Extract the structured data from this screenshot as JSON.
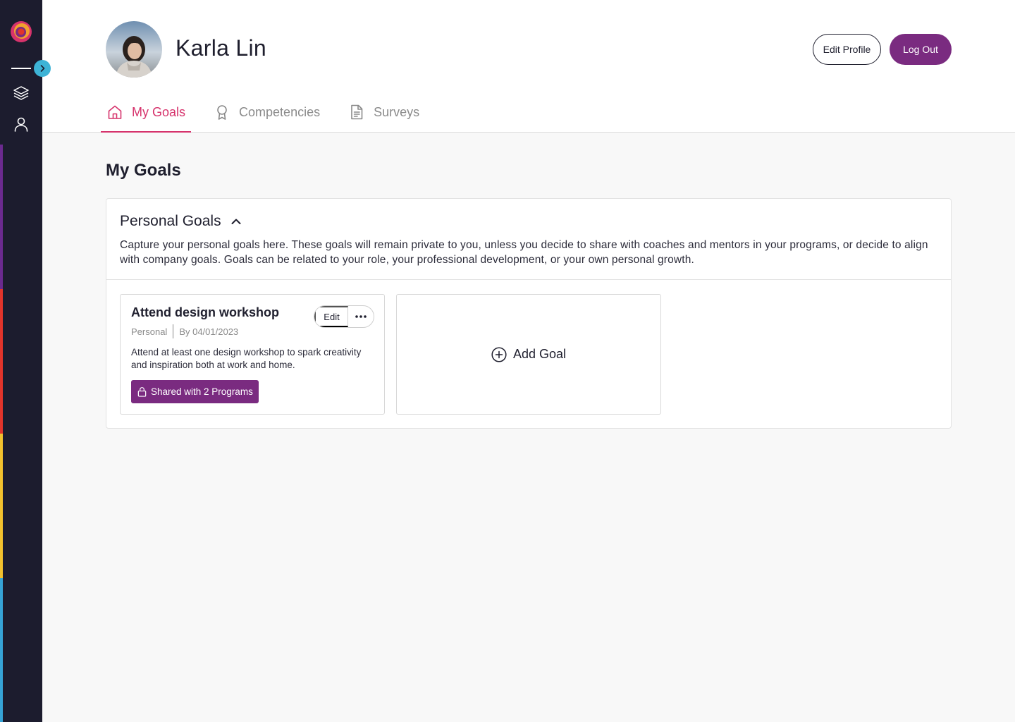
{
  "user": {
    "name": "Karla Lin"
  },
  "header": {
    "edit_profile_label": "Edit Profile",
    "logout_label": "Log Out"
  },
  "tabs": [
    {
      "label": "My Goals",
      "icon": "home-icon",
      "active": true
    },
    {
      "label": "Competencies",
      "icon": "award-icon",
      "active": false
    },
    {
      "label": "Surveys",
      "icon": "document-icon",
      "active": false
    }
  ],
  "main": {
    "page_title": "My Goals",
    "section": {
      "title": "Personal Goals",
      "description": "Capture your personal goals here. These goals will remain private to you, unless you decide to share with coaches and mentors in your programs, or decide to align with company goals. Goals can be related to your role, your professional development, or your own personal growth."
    },
    "goals": [
      {
        "title": "Attend design workshop",
        "category": "Personal",
        "due": "By 04/01/2023",
        "edit_label": "Edit",
        "description": "Attend at least one design workshop to spark creativity and inspiration both at work and home.",
        "shared_label": "Shared with 2 Programs"
      }
    ],
    "add_goal_label": "Add Goal"
  },
  "colors": {
    "sidebar_bg": "#1c1c2e",
    "accent_pink": "#d6336c",
    "primary_purple": "#7a2b80",
    "expand_blue": "#3db3d6"
  }
}
